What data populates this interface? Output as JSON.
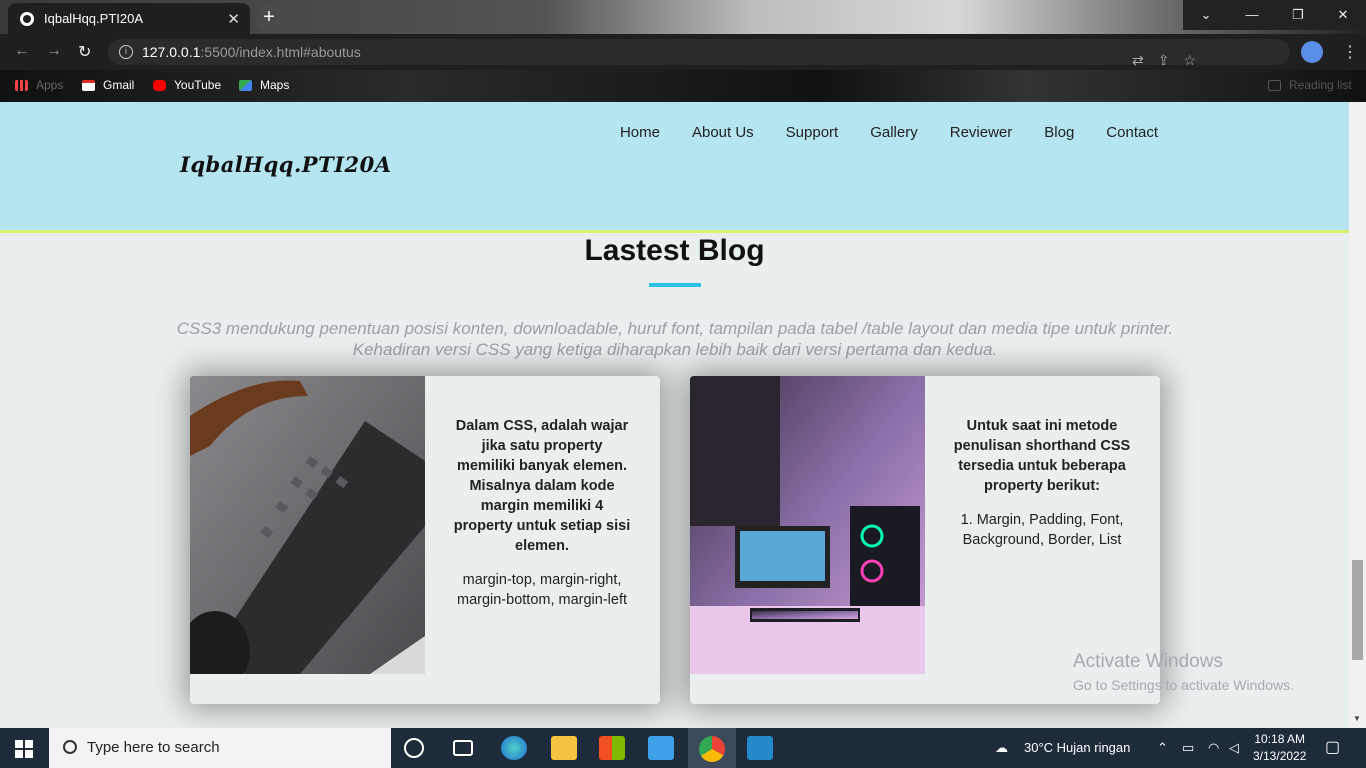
{
  "browser": {
    "tab_title": "IqbalHqq.PTI20A",
    "tab_close": "✕",
    "new_tab": "+",
    "url_host": "127.0.0.1",
    "url_path": ":5500/index.html#aboutus",
    "bookmarks": [
      {
        "label": "Apps",
        "icon": "apps-grid-icon",
        "color": "#4a4a4a"
      },
      {
        "label": "Gmail",
        "icon": "gmail-icon",
        "color": "#d93025"
      },
      {
        "label": "YouTube",
        "icon": "youtube-icon",
        "color": "#ff0000"
      },
      {
        "label": "Maps",
        "icon": "maps-icon",
        "color": "#34a853"
      }
    ],
    "reading_list": "Reading list"
  },
  "site": {
    "logo": "IqbalHqq.PTI20A",
    "nav": [
      "Home",
      "About Us",
      "Support",
      "Gallery",
      "Reviewer",
      "Blog",
      "Contact"
    ],
    "header_bg": "#b6e5f2",
    "accent_border": "#d9f36c"
  },
  "blog": {
    "title": "Lastest Blog",
    "intro": "CSS3 mendukung penentuan posisi konten, downloadable, huruf font, tampilan pada tabel /table layout dan media tipe untuk printer. Kehadiran versi CSS yang ketiga diharapkan lebih baik dari versi pertama dan kedua.",
    "cards": [
      {
        "heading": "Dalam CSS, adalah wajar jika satu property memiliki banyak elemen. Misalnya dalam kode margin memiliki 4 property untuk setiap sisi elemen.",
        "body": "margin-top, margin-right, margin-bottom, margin-left",
        "image": "keyboard-photo"
      },
      {
        "heading": "Untuk saat ini metode penulisan shorthand CSS tersedia untuk beberapa property berikut:",
        "body": "1. Margin, Padding, Font, Background, Border, List",
        "image": "gaming-setup-photo"
      }
    ]
  },
  "watermark": {
    "title": "Activate Windows",
    "subtitle": "Go to Settings to activate Windows."
  },
  "taskbar": {
    "search_placeholder": "Type here to search",
    "weather": "30°C  Hujan ringan",
    "time": "10:18 AM",
    "date": "3/13/2022"
  }
}
